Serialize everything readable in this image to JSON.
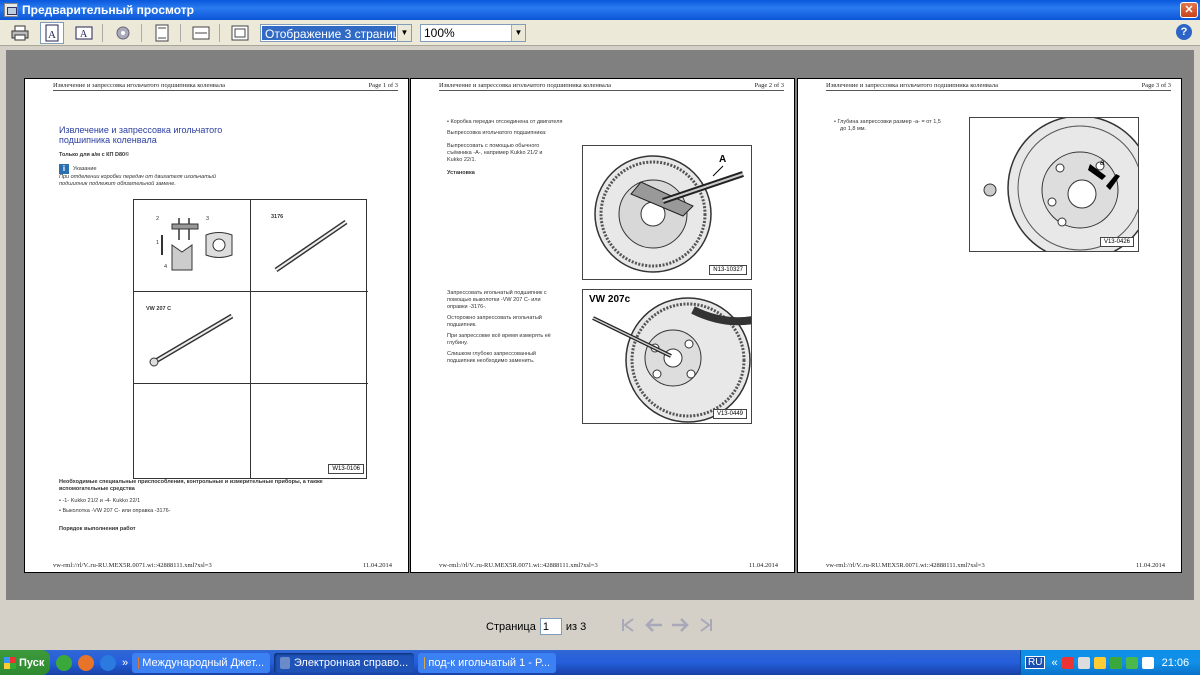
{
  "window": {
    "title": "Предварительный просмотр",
    "close_glyph": "✕"
  },
  "toolbar": {
    "display_mode": "Отображение 3 страниц",
    "zoom": "100%",
    "help_glyph": "?"
  },
  "pages": [
    {
      "header_left": "Извлечение и запрессовка игольчатого подшипника коленвала",
      "header_right": "Page 1 of 3",
      "footer_left": "vw-rml://rl/V..ru-RU.MEX5R.0071.wi::42888111.xml?xsl=3",
      "footer_right": "11.04.2014",
      "title_line1": "Извлечение и запрессовка игольчатого",
      "title_line2": "подшипника коленвала",
      "subtitle": "Только для а/м с КП D80©",
      "note_label": "Указание",
      "note_text_1": "При отделении коробки передач от двигателя игольчатый",
      "note_text_2": "подшипник подлежит обязательной замене.",
      "grid_label_2": "2",
      "grid_label_3": "3",
      "grid_label_1": "1",
      "grid_label_4": "4",
      "grid_label_3176": "3176",
      "grid_label_vw": "VW 207 C",
      "figure_code": "W13-0106",
      "tools_heading_1": "Необходимые специальные приспособления, контрольные и измерительные приборы, а также",
      "tools_heading_2": "вспомогательные средства",
      "tool_1": "-1- Kukko 21/2 и -4- Kukko 22/1",
      "tool_2": "Выколотка -VW 207 C- или оправка -3176-",
      "procedure": "Порядок выполнения работ"
    },
    {
      "header_left": "Извлечение и запрессовка игольчатого подшипника коленвала",
      "header_right": "Page 2 of 3",
      "footer_left": "vw-rml://rl/V..ru-RU.MEX5R.0071.wi::42888111.xml?xsl=3",
      "footer_right": "11.04.2014",
      "bullet_1": "Коробка передач отсоединена от двигателя",
      "section_1": "Выпрессовка игольчатого подшипника:",
      "step_1a": "Выпрессовать с помощью обычного",
      "step_1b": "съёмника -А-, например Kukko 21/2 и",
      "step_1c": "Kukko 22/1.",
      "section_2": "Установка",
      "fig1_label": "A",
      "fig1_code": "N13-10327",
      "step_2a": "Запрессовать игольчатый подшипник с",
      "step_2b": "помощью выколотки -VW 207 C- или",
      "step_2c": "оправки -3176-.",
      "step_3a": "Осторожно запрессовать игольчатый",
      "step_3b": "подшипник.",
      "step_4a": "При запрессовке всё время измерять её",
      "step_4b": "глубину.",
      "warn_a": "Слишком глубоко запрессованный",
      "warn_b": "подшипник необходимо заменить.",
      "fig2_label": "VW 207c",
      "fig2_code": "V13-0449"
    },
    {
      "header_left": "Извлечение и запрессовка игольчатого подшипника коленвала",
      "header_right": "Page 3 of 3",
      "footer_left": "vw-rml://rl/V..ru-RU.MEX5R.0071.wi::42888111.xml?xsl=3",
      "footer_right": "11.04.2014",
      "bullet_1a": "Глубина запрессовки размер -а- = от 1,5",
      "bullet_1b": "до 1,8 мм.",
      "fig_label": "a",
      "fig_code": "V13-0426"
    }
  ],
  "navigation": {
    "page_label": "Страница",
    "current_page": "1",
    "of_label": "из 3"
  },
  "taskbar": {
    "start_label": "Пуск",
    "overflow": "»",
    "tasks": [
      "Международный Джет...",
      "Электронная справо...",
      "под-к игольчатый 1 - P..."
    ],
    "language": "RU",
    "tray_overflow": "«",
    "clock": "21:06"
  }
}
